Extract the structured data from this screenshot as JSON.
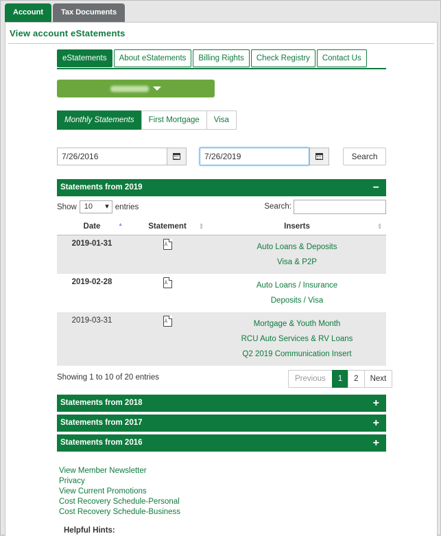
{
  "outer_tabs": [
    {
      "label": "Account"
    },
    {
      "label": "Tax Documents"
    }
  ],
  "panel_title": "View account eStatements",
  "inner_tabs": [
    {
      "label": "eStatements"
    },
    {
      "label": "About eStatements"
    },
    {
      "label": "Billing Rights"
    },
    {
      "label": "Check Registry"
    },
    {
      "label": "Contact Us"
    }
  ],
  "statement_types": [
    {
      "label": "Monthly Statements"
    },
    {
      "label": "First Mortgage"
    },
    {
      "label": "Visa"
    }
  ],
  "date_range": {
    "start": "7/26/2016",
    "end": "7/26/2019"
  },
  "search_label": "Search",
  "sections": {
    "current": {
      "label": "Statements from 2019",
      "toggle": "−"
    },
    "collapsed": [
      {
        "label": "Statements from 2018",
        "toggle": "+"
      },
      {
        "label": "Statements from 2017",
        "toggle": "+"
      },
      {
        "label": "Statements from 2016",
        "toggle": "+"
      }
    ]
  },
  "table_controls": {
    "show_label": "Show",
    "length": "10",
    "entries_label": "entries",
    "search_label": "Search:"
  },
  "table": {
    "headers": [
      "Date",
      "Statement",
      "Inserts"
    ],
    "rows": [
      {
        "date": "2019-01-31",
        "inserts": [
          "Auto Loans & Deposits",
          "Visa & P2P"
        ]
      },
      {
        "date": "2019-02-28",
        "inserts": [
          "Auto Loans / Insurance",
          "Deposits / Visa"
        ]
      },
      {
        "date": "2019-03-31",
        "inserts": [
          "Mortgage & Youth Month",
          "RCU Auto Services & RV Loans",
          "Q2 2019 Communication Insert"
        ]
      }
    ]
  },
  "info": "Showing 1 to 10 of 20 entries",
  "pagination": {
    "previous": "Previous",
    "pages": [
      "1",
      "2"
    ],
    "next": "Next"
  },
  "footer_links": [
    "View Member Newsletter",
    "Privacy",
    "View Current Promotions",
    "Cost Recovery Schedule-Personal",
    "Cost Recovery Schedule-Business"
  ],
  "helpful_hints": "Helpful Hints:",
  "colors": {
    "brand_green": "#0e7a3d",
    "dropdown_green": "#6ca73d"
  }
}
